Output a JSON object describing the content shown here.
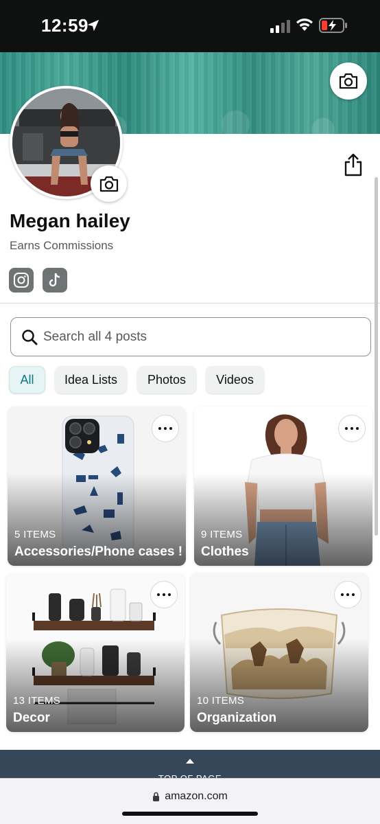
{
  "status_bar": {
    "time": "12:59",
    "battery_color": "#ff3b30"
  },
  "profile": {
    "name": "Megan hailey",
    "subtitle": "Earns Commissions",
    "social": [
      "instagram-icon",
      "tiktok-icon"
    ]
  },
  "search": {
    "placeholder": "Search all 4 posts"
  },
  "filters": [
    "All",
    "Idea Lists",
    "Photos",
    "Videos"
  ],
  "lists": [
    {
      "count": "5 ITEMS",
      "title": "Accessories/Phone cases !"
    },
    {
      "count": "9 ITEMS",
      "title": "Clothes"
    },
    {
      "count": "13 ITEMS",
      "title": "Decor"
    },
    {
      "count": "10 ITEMS",
      "title": "Organization"
    }
  ],
  "footer": {
    "label": "TOP OF PAGE"
  },
  "browser": {
    "url": "amazon.com"
  },
  "colors": {
    "banner": "#3a9c8e",
    "active_chip": "#087a85",
    "footer": "#37475a"
  }
}
